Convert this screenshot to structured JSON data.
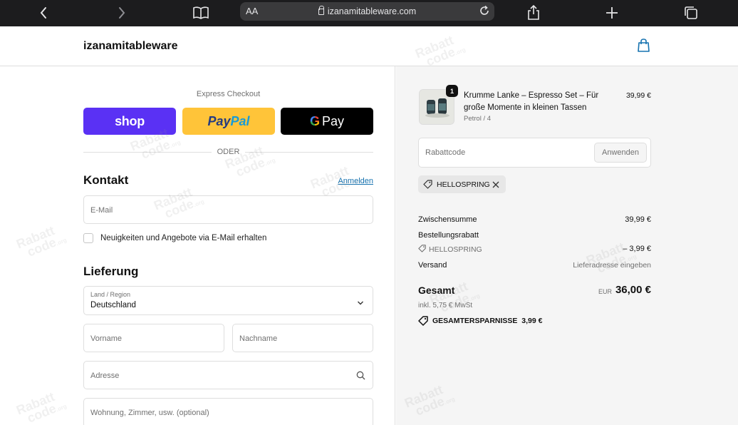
{
  "browser": {
    "text_size_label": "AA",
    "url": "izanamitableware.com"
  },
  "header": {
    "shop_name": "izanamitableware"
  },
  "express": {
    "label": "Express Checkout",
    "shop_pay": "shop",
    "paypal_part1": "Pay",
    "paypal_part2": "Pal",
    "google_pay_g": "G",
    "google_pay_text": "Pay",
    "divider": "ODER"
  },
  "contact": {
    "title": "Kontakt",
    "login_link": "Anmelden",
    "email_placeholder": "E-Mail",
    "newsletter_label": "Neuigkeiten und Angebote via E-Mail erhalten"
  },
  "delivery": {
    "title": "Lieferung",
    "country_label": "Land / Region",
    "country_value": "Deutschland",
    "first_name_placeholder": "Vorname",
    "last_name_placeholder": "Nachname",
    "address_placeholder": "Adresse",
    "apartment_placeholder": "Wohnung, Zimmer, usw. (optional)"
  },
  "summary": {
    "product": {
      "quantity": "1",
      "name": "Krumme Lanke – Espresso Set – Für große Momente in kleinen Tassen",
      "variant": "Petrol / 4",
      "price": "39,99 €"
    },
    "discount_placeholder": "Rabattcode",
    "apply_label": "Anwenden",
    "applied_code": "HELLOSPRING",
    "subtotal_label": "Zwischensumme",
    "subtotal_value": "39,99 €",
    "order_discount_label": "Bestellungsrabatt",
    "order_discount_code": "HELLOSPRING",
    "order_discount_value": "– 3,99 €",
    "shipping_label": "Versand",
    "shipping_value": "Lieferadresse eingeben",
    "total_label": "Gesamt",
    "total_currency": "EUR",
    "total_value": "36,00 €",
    "tax_note": "inkl. 5,75 € MwSt",
    "savings_label": "GESAMTERSPARNISSE",
    "savings_value": "3,99 €"
  },
  "watermark": {
    "line1": "Rabatt",
    "line2": "code",
    "suffix": ".org"
  },
  "colors": {
    "shop_pay": "#5a31f4",
    "paypal": "#ffc439",
    "google_pay": "#000000",
    "link": "#1773b0",
    "summary_bg": "#f5f5f5"
  }
}
